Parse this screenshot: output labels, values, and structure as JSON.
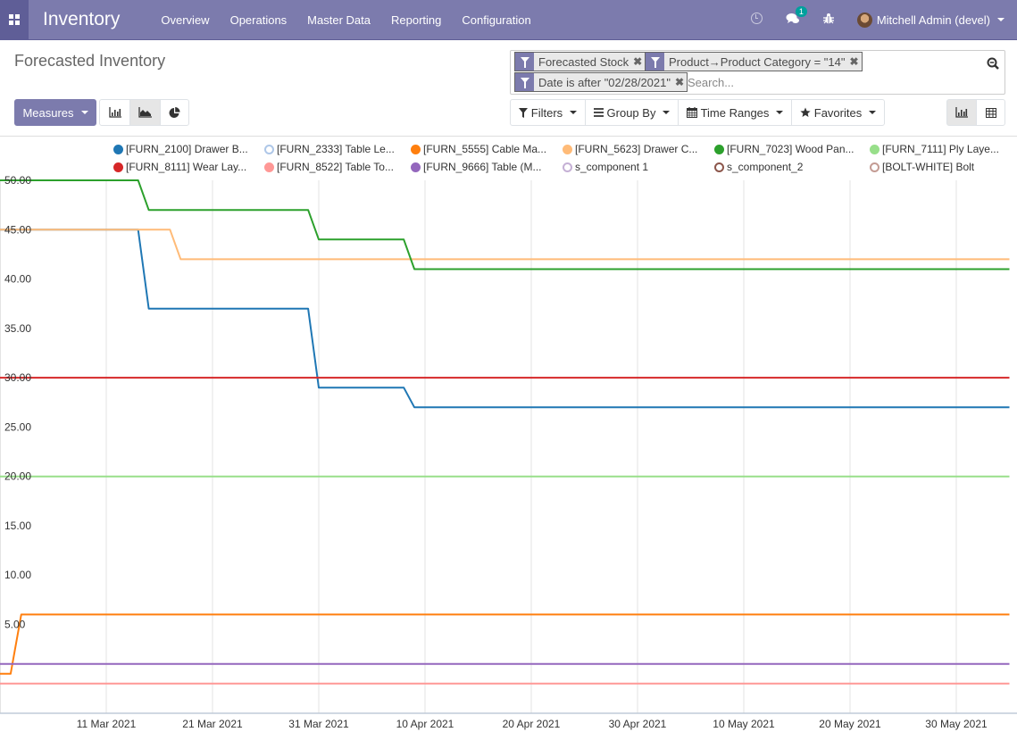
{
  "navbar": {
    "app_title": "Inventory",
    "menu": [
      "Overview",
      "Operations",
      "Master Data",
      "Reporting",
      "Configuration"
    ],
    "messages_badge": "1",
    "user": "Mitchell Admin (devel)"
  },
  "page": {
    "title": "Forecasted Inventory"
  },
  "search": {
    "facets": [
      {
        "label": "Forecasted Stock"
      },
      {
        "label": "Product→Product Category = \"14\""
      },
      {
        "label": "Date is after \"02/28/2021\""
      }
    ],
    "placeholder": "Search..."
  },
  "toolbar": {
    "measures_label": "Measures",
    "filters_label": "Filters",
    "groupby_label": "Group By",
    "timeranges_label": "Time Ranges",
    "favorites_label": "Favorites",
    "chart_modes": [
      "bar-chart",
      "line-chart",
      "pie-chart"
    ],
    "active_chart_mode": "line-chart",
    "views": [
      "graph",
      "pivot"
    ],
    "active_view": "graph"
  },
  "chart_data": {
    "type": "line",
    "title": "",
    "xlabel": "",
    "ylabel": "",
    "x_start": "2021-03-01",
    "x_end": "2021-06-04",
    "ylim": [
      -4,
      50
    ],
    "y_ticks": [
      5,
      10,
      15,
      20,
      25,
      30,
      35,
      40,
      45,
      50
    ],
    "y_tick_labels": [
      "5.00",
      "10.00",
      "15.00",
      "20.00",
      "25.00",
      "30.00",
      "35.00",
      "40.00",
      "45.00",
      "50.00"
    ],
    "x_ticks": [
      "2021-03-11",
      "2021-03-21",
      "2021-03-31",
      "2021-04-10",
      "2021-04-20",
      "2021-04-30",
      "2021-05-10",
      "2021-05-20",
      "2021-05-30"
    ],
    "x_tick_labels": [
      "11 Mar 2021",
      "21 Mar 2021",
      "31 Mar 2021",
      "10 Apr 2021",
      "20 Apr 2021",
      "30 Apr 2021",
      "10 May 2021",
      "20 May 2021",
      "30 May 2021"
    ],
    "grid": true,
    "legend_position": "top",
    "series": [
      {
        "name": "[FURN_2100] Drawer B...",
        "color": "#1f77b4",
        "hidden": false,
        "points": [
          [
            "2021-03-01",
            45
          ],
          [
            "2021-03-14",
            45
          ],
          [
            "2021-03-15",
            37
          ],
          [
            "2021-03-30",
            37
          ],
          [
            "2021-03-31",
            29
          ],
          [
            "2021-04-08",
            29
          ],
          [
            "2021-04-09",
            27
          ],
          [
            "2021-06-04",
            27
          ]
        ]
      },
      {
        "name": "[FURN_2333] Table Le...",
        "color": "#aec7e8",
        "hidden": true,
        "points": []
      },
      {
        "name": "[FURN_5555] Cable Ma...",
        "color": "#ff7f0e",
        "hidden": false,
        "points": [
          [
            "2021-03-01",
            0
          ],
          [
            "2021-03-02",
            0
          ],
          [
            "2021-03-03",
            6
          ],
          [
            "2021-06-04",
            6
          ]
        ]
      },
      {
        "name": "[FURN_5623] Drawer C...",
        "color": "#ffbb78",
        "hidden": false,
        "points": [
          [
            "2021-03-01",
            45
          ],
          [
            "2021-03-17",
            45
          ],
          [
            "2021-03-18",
            42
          ],
          [
            "2021-06-04",
            42
          ]
        ]
      },
      {
        "name": "[FURN_7023] Wood Pan...",
        "color": "#2ca02c",
        "hidden": false,
        "points": [
          [
            "2021-03-01",
            50
          ],
          [
            "2021-03-14",
            50
          ],
          [
            "2021-03-15",
            47
          ],
          [
            "2021-03-30",
            47
          ],
          [
            "2021-03-31",
            44
          ],
          [
            "2021-04-08",
            44
          ],
          [
            "2021-04-09",
            41
          ],
          [
            "2021-06-04",
            41
          ]
        ]
      },
      {
        "name": "[FURN_7111] Ply Laye...",
        "color": "#98df8a",
        "hidden": false,
        "points": [
          [
            "2021-03-01",
            20
          ],
          [
            "2021-06-04",
            20
          ]
        ]
      },
      {
        "name": "[FURN_8111] Wear Lay...",
        "color": "#d62728",
        "hidden": false,
        "points": [
          [
            "2021-03-01",
            30
          ],
          [
            "2021-06-04",
            30
          ]
        ]
      },
      {
        "name": "[FURN_8522] Table To...",
        "color": "#ff9896",
        "hidden": false,
        "points": [
          [
            "2021-03-01",
            -1
          ],
          [
            "2021-06-04",
            -1
          ]
        ]
      },
      {
        "name": "[FURN_9666] Table (M...",
        "color": "#9467bd",
        "hidden": false,
        "points": [
          [
            "2021-03-01",
            1
          ],
          [
            "2021-06-04",
            1
          ]
        ]
      },
      {
        "name": "s_component 1",
        "color": "#c5b0d5",
        "hidden": true,
        "points": []
      },
      {
        "name": "s_component_2",
        "color": "#8c564b",
        "hidden": true,
        "points": []
      },
      {
        "name": "[BOLT-WHITE] Bolt",
        "color": "#c49c94",
        "hidden": true,
        "points": []
      }
    ]
  }
}
